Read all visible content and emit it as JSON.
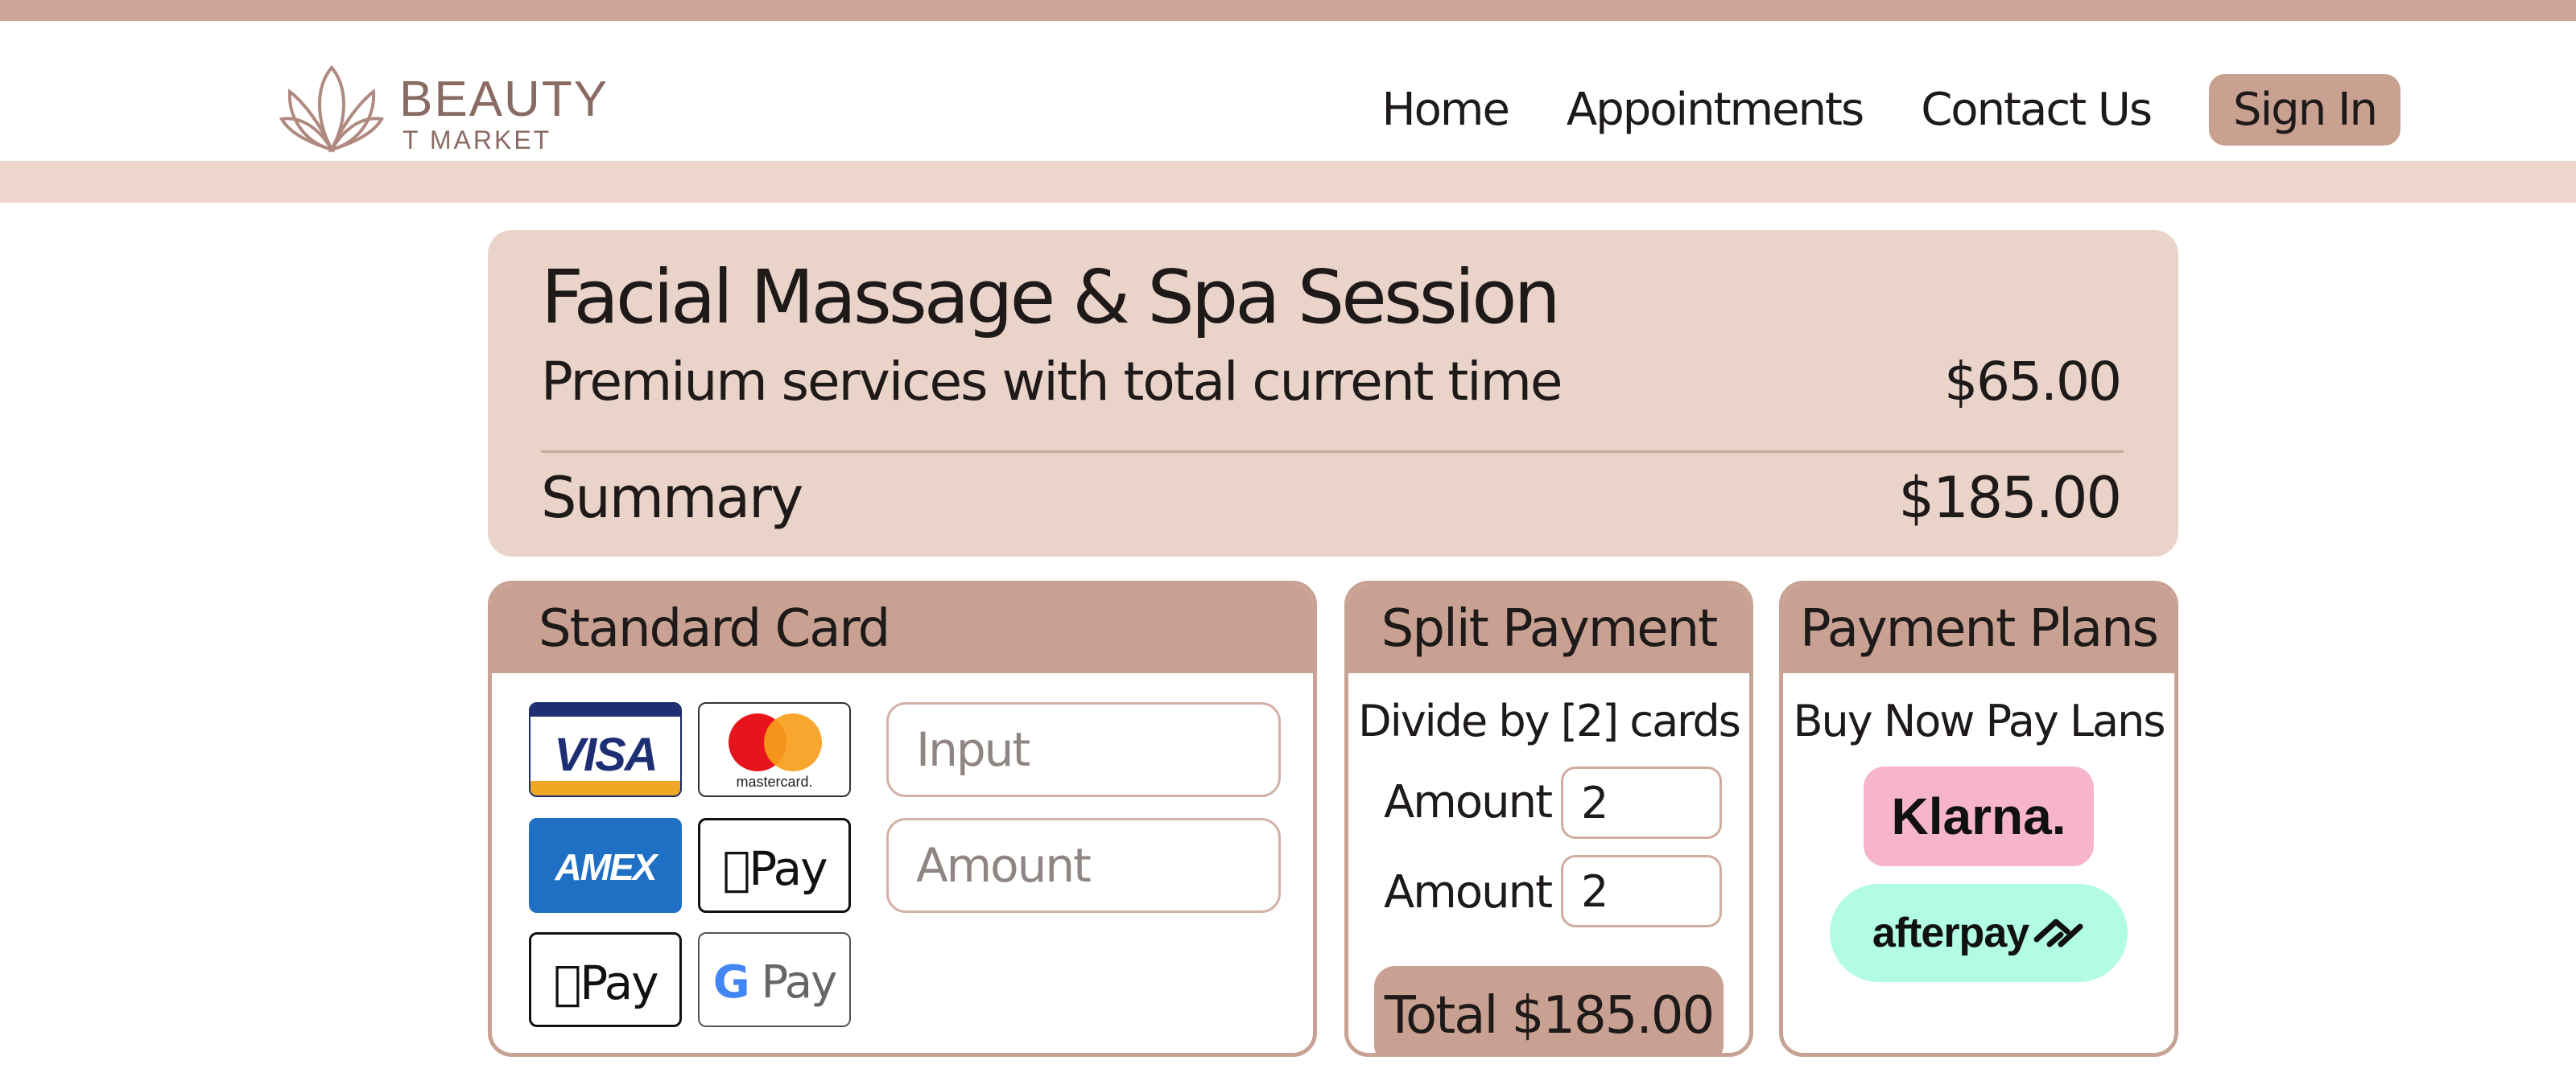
{
  "brand": {
    "name": "BEAUTY",
    "tagline": "T MARKET",
    "logo_icon": "lotus-icon"
  },
  "nav": {
    "home": "Home",
    "appointments": "Appointments",
    "contact": "Contact Us",
    "sign_in": "Sign In"
  },
  "summary": {
    "title": "Facial Massage & Spa Session",
    "subtitle": "Premium services with total current time",
    "subtitle_price": "$65.00",
    "summary_label": "Summary",
    "summary_total": "$185.00"
  },
  "standard_card": {
    "title": "Standard Card",
    "logos": {
      "visa": "VISA",
      "mastercard": "mastercard.",
      "amex": "AMEX",
      "apple_pay": "Pay",
      "google_pay_g": "G",
      "google_pay": "Pay"
    },
    "input_placeholder": "Input",
    "amount_placeholder": "Amount"
  },
  "split_payment": {
    "title": "Split Payment",
    "description": "Divide by [2] cards",
    "amount_label_1": "Amount",
    "amount_value_1": "2",
    "amount_label_2": "Amount",
    "amount_value_2": "2",
    "total_button": "Total $185.00"
  },
  "payment_plans": {
    "title": "Payment Plans",
    "description": "Buy Now Pay Lans",
    "klarna": "Klarna.",
    "afterpay": "afterpay"
  },
  "colors": {
    "accent": "#c9a192",
    "panel_bg": "#ead3c9",
    "top_strip": "#cda697",
    "sub_strip": "#eed6cc",
    "klarna_bg": "#f7b5c9",
    "afterpay_bg": "#b2fce4"
  }
}
